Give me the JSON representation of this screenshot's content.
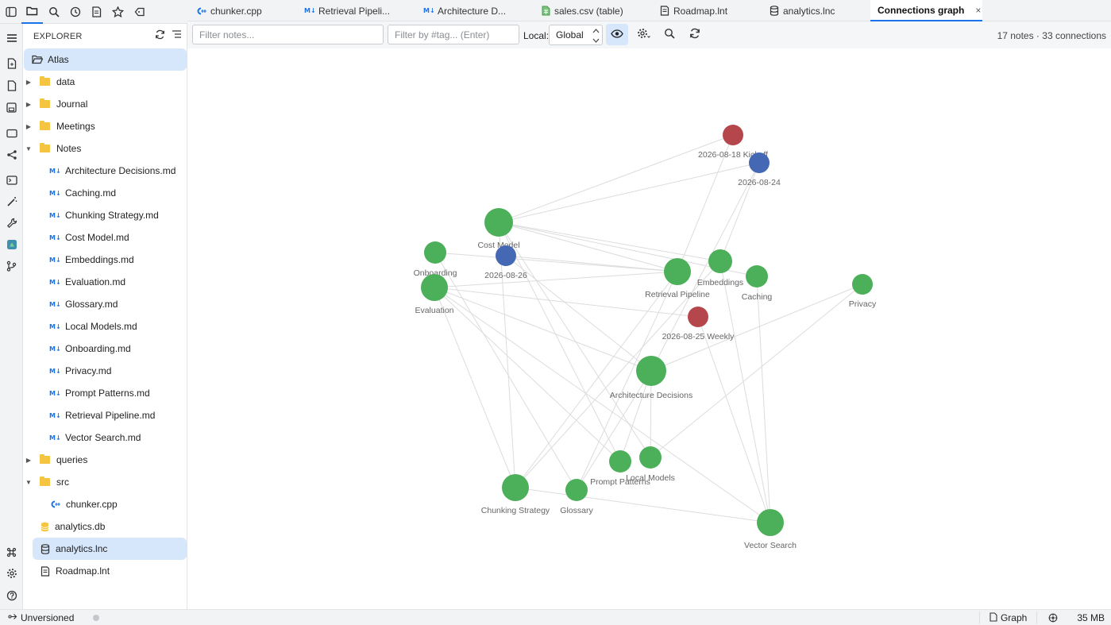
{
  "tabs": [
    {
      "label": "chunker.cpp",
      "icon": "cpp-icon"
    },
    {
      "label": "Retrieval Pipeli...",
      "icon": "markdown-icon"
    },
    {
      "label": "Architecture D...",
      "icon": "markdown-icon"
    },
    {
      "label": "sales.csv (table)",
      "icon": "spreadsheet-icon"
    },
    {
      "label": "Roadmap.lnt",
      "icon": "note-icon"
    },
    {
      "label": "analytics.lnc",
      "icon": "database-icon"
    },
    {
      "label": "Connections graph",
      "icon": "",
      "close": "×"
    }
  ],
  "explorer": {
    "title": "EXPLORER",
    "root": "Atlas",
    "items": [
      {
        "label": "data",
        "type": "folder",
        "expanded": false
      },
      {
        "label": "Journal",
        "type": "folder",
        "expanded": false
      },
      {
        "label": "Meetings",
        "type": "folder",
        "expanded": false
      },
      {
        "label": "Notes",
        "type": "folder",
        "expanded": true
      },
      {
        "label": "Architecture Decisions.md",
        "type": "markdown"
      },
      {
        "label": "Caching.md",
        "type": "markdown"
      },
      {
        "label": "Chunking Strategy.md",
        "type": "markdown"
      },
      {
        "label": "Cost Model.md",
        "type": "markdown"
      },
      {
        "label": "Embeddings.md",
        "type": "markdown"
      },
      {
        "label": "Evaluation.md",
        "type": "markdown"
      },
      {
        "label": "Glossary.md",
        "type": "markdown"
      },
      {
        "label": "Local Models.md",
        "type": "markdown"
      },
      {
        "label": "Onboarding.md",
        "type": "markdown"
      },
      {
        "label": "Privacy.md",
        "type": "markdown"
      },
      {
        "label": "Prompt Patterns.md",
        "type": "markdown"
      },
      {
        "label": "Retrieval Pipeline.md",
        "type": "markdown"
      },
      {
        "label": "Vector Search.md",
        "type": "markdown"
      },
      {
        "label": "queries",
        "type": "folder",
        "expanded": false
      },
      {
        "label": "src",
        "type": "folder",
        "expanded": true
      },
      {
        "label": "chunker.cpp",
        "type": "cpp"
      },
      {
        "label": "analytics.db",
        "type": "db"
      },
      {
        "label": "analytics.lnc",
        "type": "lnc",
        "selected": true
      },
      {
        "label": "Roadmap.lnt",
        "type": "note"
      }
    ]
  },
  "toolbar": {
    "filter_placeholder": "Filter notes...",
    "tag_placeholder": "Filter by #tag... (Enter)",
    "local_label": "Local:",
    "local_value": "Global",
    "stats": "17 notes · 33 connections"
  },
  "graph": {
    "colors": {
      "note": "#4caf5a",
      "meeting": "#b5464b",
      "journal": "#4568b4",
      "edge": "#dcdcdc"
    },
    "nodes": [
      {
        "id": "kickoff",
        "label": "2026-08-18 Kickoff",
        "kind": "meeting"
      },
      {
        "id": "d24",
        "label": "2026-08-24",
        "kind": "journal"
      },
      {
        "id": "cost",
        "label": "Cost Model",
        "kind": "note"
      },
      {
        "id": "onboarding",
        "label": "Onboarding",
        "kind": "note"
      },
      {
        "id": "d26",
        "label": "2026-08-26",
        "kind": "journal"
      },
      {
        "id": "evaluation",
        "label": "Evaluation",
        "kind": "note"
      },
      {
        "id": "retrieval",
        "label": "Retrieval Pipeline",
        "kind": "note"
      },
      {
        "id": "embeddings",
        "label": "Embeddings",
        "kind": "note"
      },
      {
        "id": "caching",
        "label": "Caching",
        "kind": "note"
      },
      {
        "id": "privacy",
        "label": "Privacy",
        "kind": "note"
      },
      {
        "id": "weekly",
        "label": "2026-08-25 Weekly",
        "kind": "meeting"
      },
      {
        "id": "arch",
        "label": "Architecture Decisions",
        "kind": "note"
      },
      {
        "id": "prompt",
        "label": "Prompt Patterns",
        "kind": "note"
      },
      {
        "id": "local",
        "label": "Local Models",
        "kind": "note"
      },
      {
        "id": "chunking",
        "label": "Chunking Strategy",
        "kind": "note"
      },
      {
        "id": "glossary",
        "label": "Glossary",
        "kind": "note"
      },
      {
        "id": "vector",
        "label": "Vector Search",
        "kind": "note"
      }
    ],
    "edges": [
      [
        "kickoff",
        "cost"
      ],
      [
        "kickoff",
        "retrieval"
      ],
      [
        "d24",
        "cost"
      ],
      [
        "d24",
        "embeddings"
      ],
      [
        "d24",
        "arch"
      ],
      [
        "cost",
        "retrieval"
      ],
      [
        "cost",
        "embeddings"
      ],
      [
        "cost",
        "caching"
      ],
      [
        "cost",
        "prompt"
      ],
      [
        "cost",
        "local"
      ],
      [
        "cost",
        "chunking"
      ],
      [
        "onboarding",
        "retrieval"
      ],
      [
        "onboarding",
        "glossary"
      ],
      [
        "d26",
        "retrieval"
      ],
      [
        "d26",
        "arch"
      ],
      [
        "evaluation",
        "retrieval"
      ],
      [
        "evaluation",
        "weekly"
      ],
      [
        "evaluation",
        "arch"
      ],
      [
        "evaluation",
        "chunking"
      ],
      [
        "evaluation",
        "prompt"
      ],
      [
        "evaluation",
        "vector"
      ],
      [
        "retrieval",
        "chunking"
      ],
      [
        "retrieval",
        "glossary"
      ],
      [
        "embeddings",
        "vector"
      ],
      [
        "embeddings",
        "chunking"
      ],
      [
        "caching",
        "vector"
      ],
      [
        "privacy",
        "arch"
      ],
      [
        "privacy",
        "local"
      ],
      [
        "weekly",
        "vector"
      ],
      [
        "arch",
        "prompt"
      ],
      [
        "arch",
        "local"
      ],
      [
        "chunking",
        "vector"
      ],
      [
        "glossary",
        "arch"
      ]
    ]
  },
  "status": {
    "branch": "Unversioned",
    "view": "Graph",
    "memory": "35 MB"
  }
}
